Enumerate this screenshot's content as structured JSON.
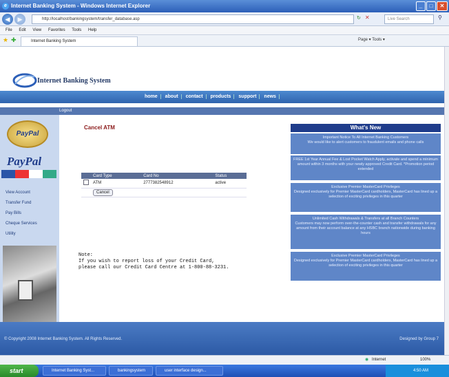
{
  "window": {
    "title": "Internet Banking System - Windows Internet Explorer"
  },
  "browser": {
    "address": "http://localhost/bankingsystem/transfer_database.asp",
    "search_placeholder": "Live Search",
    "menu": [
      "File",
      "Edit",
      "View",
      "Favorites",
      "Tools",
      "Help"
    ],
    "tab_title": "Internet Banking System",
    "commands": "Page ▾  Tools ▾"
  },
  "site": {
    "name": "Internet Banking System",
    "nav": [
      "home",
      "about",
      "contact",
      "products",
      "support",
      "news"
    ],
    "logout": "Logout"
  },
  "sidebar": {
    "paypal_badge": "PayPal",
    "paypal_logo": "PayPal",
    "items": [
      "View Account",
      "Transfer Fund",
      "Pay Bills",
      "Cheque Services",
      "Utility"
    ]
  },
  "main": {
    "title": "Cancel ATM",
    "table_headers": [
      "Card Type",
      "Card No",
      "Status"
    ],
    "row": {
      "type": "ATM",
      "number": "2777382548912",
      "status": "active"
    },
    "cancel_label": "Cancel",
    "note": "Note:\nIf you wish to report loss of your Credit Card,\nplease call our Credit Card Centre at 1-800-88-3231."
  },
  "whats_new": {
    "heading": "What's New",
    "items": [
      "Important Notice To All Internet Banking Customers\nWe would like to alert customers to fraudulent emails and phone calls",
      "FREE 1st Year Annual Fee & Lost Pocket Watch Apply, activate and spend a minimum amount within 3 months with your newly approved Credit Card. *Promotion period extended",
      "Exclusive Premier MasterCard Privileges\nDesigned exclusively for Premier MasterCard cardholders, MasterCard has lined up a selection of exciting privileges in this quarter",
      "Unlimited Cash Withdrawals & Transfers at all Branch Counters\nCustomers may now perform over-the-counter cash and transfer withdrawals for any amount from their account balance at any HSBC branch nationwide during banking hours",
      "Exclusive Premier MasterCard Privileges\nDesigned exclusively for Premier MasterCard cardholders, MasterCard has lined up a selection of exciting privileges in this quarter"
    ]
  },
  "footer": {
    "copyright": "© Copyright 2008 Internet Banking System. All Rights Reserved.",
    "credit": "Designed by Group 7"
  },
  "status": {
    "zone": "Internet",
    "zoom": "100%"
  },
  "taskbar": {
    "start": "start",
    "buttons": [
      "Internet Banking Syst...",
      "bankingsystem",
      "user interface design..."
    ],
    "clock": "4:50 AM"
  }
}
